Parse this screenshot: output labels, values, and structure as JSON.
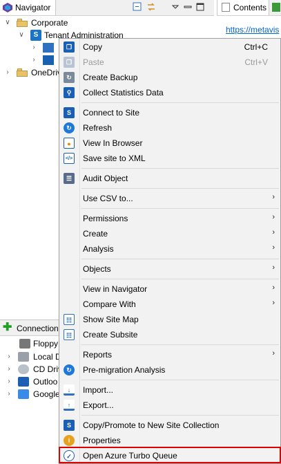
{
  "navigator": {
    "tab_label": "Navigator",
    "tree": [
      {
        "label": "Corporate"
      },
      {
        "label": "Tenant Administration"
      },
      {
        "label": ""
      },
      {
        "label": ""
      },
      {
        "label": "OneDriv"
      }
    ]
  },
  "contents": {
    "tab_label": "Contents",
    "url": "https://metavis"
  },
  "connections": {
    "tab_label": "Connection",
    "items": [
      "Floppy",
      "Local D",
      "CD Driv",
      "Outloo",
      "Google"
    ]
  },
  "menu": {
    "items": [
      {
        "label": "Copy",
        "shortcut": "Ctrl+C",
        "icon": "copy-icon"
      },
      {
        "label": "Paste",
        "shortcut": "Ctrl+V",
        "icon": "paste-icon",
        "disabled": true
      },
      {
        "label": "Create Backup",
        "icon": "backup-icon"
      },
      {
        "label": "Collect Statistics Data",
        "icon": "statistics-icon"
      },
      {
        "label": "Connect to Site",
        "icon": "connect-icon"
      },
      {
        "label": "Refresh",
        "icon": "refresh-icon"
      },
      {
        "label": "View In Browser",
        "icon": "browser-icon"
      },
      {
        "label": "Save site to XML",
        "icon": "xml-icon"
      },
      {
        "label": "Audit Object",
        "icon": "audit-icon"
      },
      {
        "label": "Use CSV to...",
        "submenu": true
      },
      {
        "label": "Permissions",
        "submenu": true
      },
      {
        "label": "Create",
        "submenu": true
      },
      {
        "label": "Analysis",
        "submenu": true
      },
      {
        "label": "Objects",
        "submenu": true
      },
      {
        "label": "View in Navigator",
        "submenu": true
      },
      {
        "label": "Compare With",
        "submenu": true
      },
      {
        "label": "Show Site Map",
        "icon": "site-map-icon"
      },
      {
        "label": "Create Subsite",
        "icon": "subsite-icon"
      },
      {
        "label": "Reports",
        "submenu": true
      },
      {
        "label": "Pre-migration Analysis",
        "icon": "premigration-icon"
      },
      {
        "label": "Import...",
        "icon": "import-icon"
      },
      {
        "label": "Export...",
        "icon": "export-icon"
      },
      {
        "label": "Copy/Promote to New Site Collection",
        "icon": "promote-icon"
      },
      {
        "label": "Properties",
        "icon": "properties-icon"
      },
      {
        "label": "Open Azure Turbo Queue",
        "icon": "azure-turbo-icon"
      }
    ]
  }
}
